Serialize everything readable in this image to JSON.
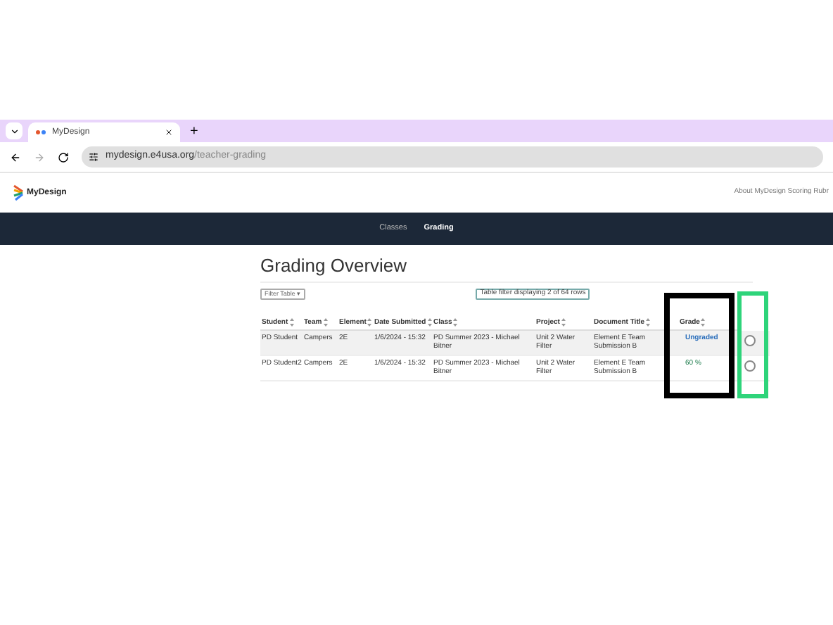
{
  "browser": {
    "tab_title": "MyDesign",
    "new_tab": "+",
    "url_host": "mydesign.e4usa.org",
    "url_path": "/teacher-grading"
  },
  "header": {
    "logo_text": "MyDesign",
    "link": "About MyDesign Scoring Rubr"
  },
  "nav": [
    {
      "label": "Classes",
      "selected": false
    },
    {
      "label": "Grading",
      "selected": true
    }
  ],
  "page": {
    "title": "Grading Overview",
    "filter_button": "Filter Table",
    "filter_caret": "▾",
    "filter_status": "Table filter displaying 2 of 64 rows"
  },
  "table": {
    "columns": [
      "Student",
      "Team",
      "Element",
      "Date Submitted",
      "Class",
      "Project",
      "Document Title",
      "Grade"
    ],
    "rows": [
      {
        "cells": [
          "PD Student",
          "Campers",
          "2E",
          "1/6/2024 - 15:32",
          "PD Summer 2023 - Michael Bitner",
          "Unit 2 Water Filter",
          "Element E Team Submission B",
          "Ungraded"
        ],
        "graded": false
      },
      {
        "cells": [
          "PD Student2",
          "Campers",
          "2E",
          "1/6/2024 - 15:32",
          "PD Summer 2023 - Michael Bitner",
          "Unit 2 Water Filter",
          "Element E Team Submission B",
          "60 %"
        ],
        "graded": true
      }
    ]
  }
}
